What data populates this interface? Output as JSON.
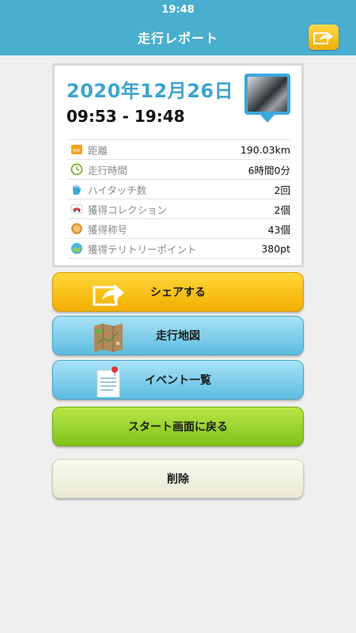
{
  "status_bar": {
    "time": "19:48"
  },
  "header": {
    "title": "走行レポート",
    "share_icon": "share-arrow-icon"
  },
  "report": {
    "date": "2020年12月26日",
    "time_range": "09:53 - 19:48",
    "stats": [
      {
        "icon": "km-icon",
        "label": "距離",
        "value": "190.03km"
      },
      {
        "icon": "clock-icon",
        "label": "走行時間",
        "value": "6時間0分"
      },
      {
        "icon": "high-five-icon",
        "label": "ハイタッチ数",
        "value": "2回"
      },
      {
        "icon": "car-collection-icon",
        "label": "獲得コレクション",
        "value": "2個"
      },
      {
        "icon": "medal-icon",
        "label": "獲得称号",
        "value": "43個"
      },
      {
        "icon": "territory-icon",
        "label": "獲得テリトリーポイント",
        "value": "380pt"
      }
    ]
  },
  "buttons": {
    "share": "シェアする",
    "map": "走行地図",
    "events": "イベント一覧",
    "back_to_start": "スタート画面に戻る",
    "delete": "削除"
  },
  "colors": {
    "header": "#4aaecf",
    "date_text": "#3ea4cf",
    "share_button": "#f5c000",
    "map_button": "#7ccbe8",
    "start_button": "#9ad32e",
    "delete_button": "#f1f1e0"
  }
}
